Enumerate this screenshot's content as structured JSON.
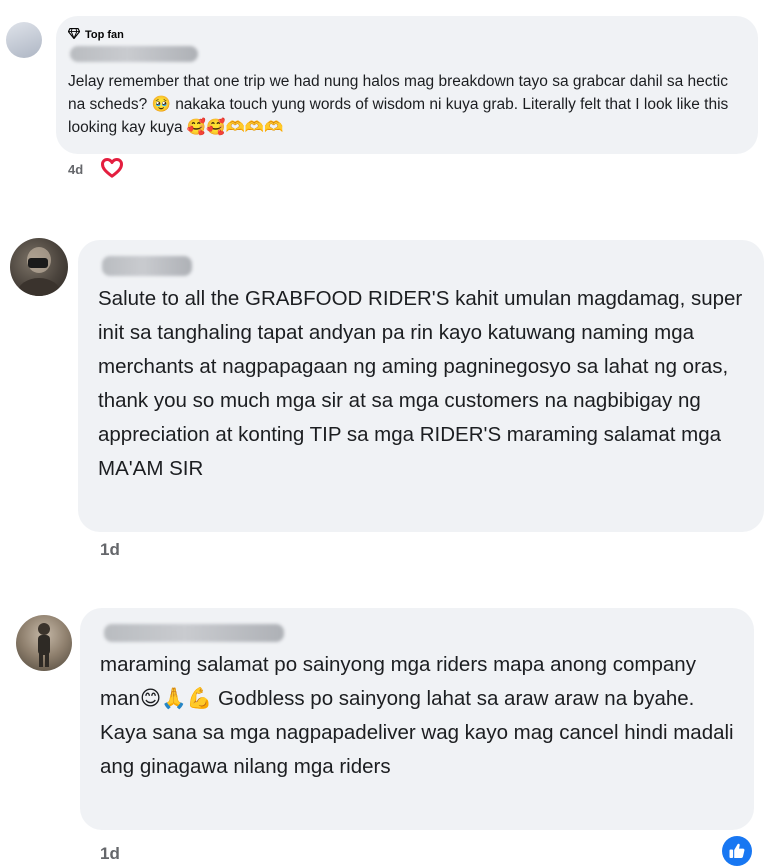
{
  "comments": [
    {
      "badge": "Top fan",
      "text": "Jelay remember that one trip we had nung halos mag breakdown tayo sa grabcar dahil sa hectic na scheds? 🥹 nakaka touch yung words of wisdom ni kuya grab. Literally felt that I look like this looking kay kuya 🥰🥰🫶🫶🫶",
      "time": "4d",
      "reaction_icon": "heart-outline-icon"
    },
    {
      "text": "Salute to all the GRABFOOD RIDER'S kahit umulan magdamag, super init sa tanghaling tapat andyan pa rin kayo katuwang naming mga merchants at nagpapagaan ng aming pagninegosyo sa lahat ng oras, thank you so much mga sir at sa mga customers na nagbibigay ng appreciation at konting TIP sa mga RIDER'S maraming salamat mga MA'AM SIR",
      "time": "1d"
    },
    {
      "text": "maraming salamat po sainyong mga riders mapa anong company man😊🙏💪 Godbless po sainyong lahat sa araw araw na byahe. Kaya sana sa mga nagpapadeliver wag kayo mag cancel hindi madali ang ginagawa nilang mga riders",
      "time": "1d",
      "reaction_icon": "thumbs-up-icon"
    }
  ],
  "colors": {
    "bubble": "#f0f2f5",
    "text": "#1c1e21",
    "time": "#65676b",
    "heart": "#e41e3f",
    "like": "#1877f2"
  }
}
